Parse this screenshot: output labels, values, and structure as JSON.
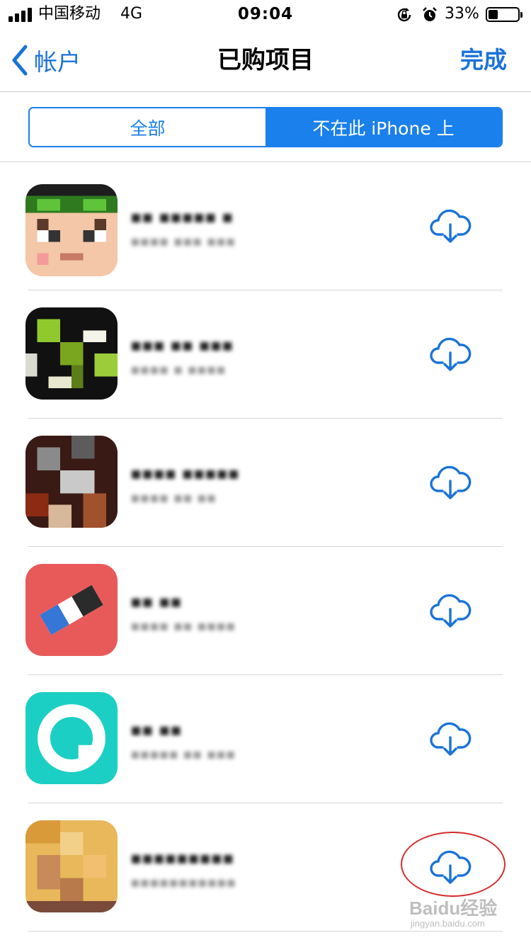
{
  "status_bar": {
    "carrier": "中国移动",
    "network": "4G",
    "time": "09:04",
    "battery_percent": "33%",
    "battery_level": 0.33
  },
  "nav": {
    "back_label": "帐户",
    "title": "已购项目",
    "done_label": "完成"
  },
  "segments": {
    "all": "全部",
    "not_on_iphone": "不在此 iPhone 上",
    "selected": "not_on_iphone"
  },
  "apps": [
    {
      "name": "▪▪ ▪▪▪▪▪ ▪",
      "subtitle": "▪▪▪▪ ▪▪▪ ▪▪▪",
      "icon": "app-icon-1"
    },
    {
      "name": "▪▪▪ ▪▪ ▪▪▪",
      "subtitle": "▪▪▪▪ ▪ ▪▪▪▪",
      "icon": "app-icon-2"
    },
    {
      "name": "▪▪▪▪ ▪▪▪▪▪",
      "subtitle": "▪▪▪▪ ▪▪ ▪▪",
      "icon": "app-icon-3"
    },
    {
      "name": "▪▪ ▪▪",
      "subtitle": "▪▪▪▪ ▪▪ ▪▪▪▪",
      "icon": "app-icon-4"
    },
    {
      "name": "▪▪ ▪▪",
      "subtitle": "▪▪▪▪▪ ▪▪ ▪▪▪",
      "icon": "app-icon-5"
    },
    {
      "name": "▪▪▪▪▪▪▪▪▪",
      "subtitle": "▪▪▪▪▪▪▪▪▪▪▪",
      "icon": "app-icon-6"
    }
  ],
  "watermark": {
    "brand": "Baidu经验",
    "url": "jingyan.baidu.com"
  },
  "colors": {
    "accent": "#1a80ec",
    "link": "#1a73d8",
    "annotation": "#d62b2b"
  }
}
